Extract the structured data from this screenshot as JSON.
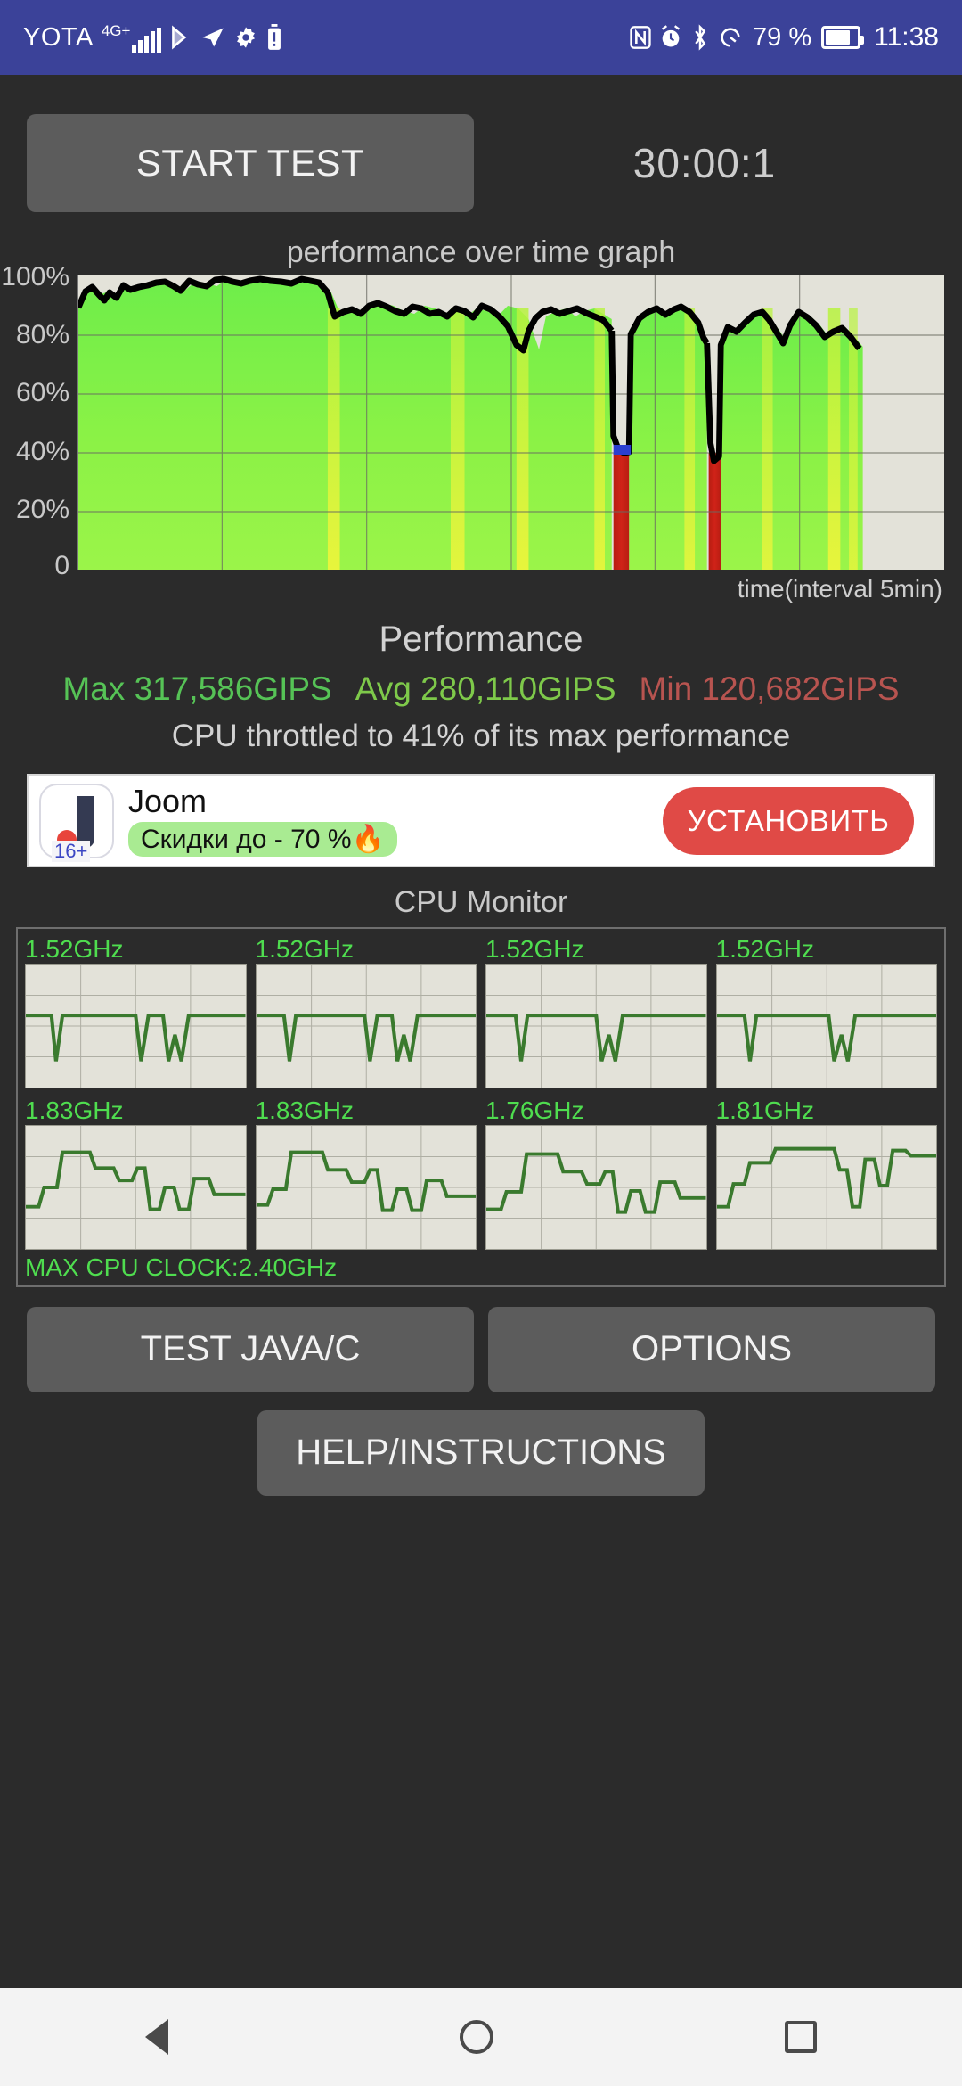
{
  "statusbar": {
    "carrier": "YOTA",
    "network": "4G+",
    "battery_percent": "79 %",
    "clock": "11:38",
    "icons": [
      "signal-bars-icon",
      "bluetooth-share-icon",
      "location-arrow-icon",
      "gear-icon",
      "warning-battery-icon",
      "nfc-icon",
      "alarm-icon",
      "bluetooth-icon",
      "data-saver-icon",
      "battery-icon"
    ]
  },
  "toolbar": {
    "start_label": "START TEST",
    "timer": "30:00:1"
  },
  "graph": {
    "title": "performance over time graph",
    "xaxis_note": "time(interval 5min)",
    "y_ticks": [
      "100%",
      "80%",
      "60%",
      "40%",
      "20%",
      "0"
    ]
  },
  "performance": {
    "heading": "Performance",
    "max_label": "Max 317,586GIPS",
    "avg_label": "Avg 280,110GIPS",
    "min_label": "Min 120,682GIPS",
    "max_color": "#56c356",
    "avg_color": "#7ec94a",
    "min_color": "#b85450",
    "throttle_note": "CPU throttled to 41% of its max performance"
  },
  "ad": {
    "app_name": "Joom",
    "promo": "Скидки до - 70 %🔥",
    "cta_label": "УСТАНОВИТЬ",
    "age_rating": "16+"
  },
  "cpu_monitor": {
    "title": "CPU Monitor",
    "max_clock_label": "MAX CPU CLOCK:2.40GHz",
    "cores": [
      {
        "freq": "1.52GHz"
      },
      {
        "freq": "1.52GHz"
      },
      {
        "freq": "1.52GHz"
      },
      {
        "freq": "1.52GHz"
      },
      {
        "freq": "1.83GHz"
      },
      {
        "freq": "1.83GHz"
      },
      {
        "freq": "1.76GHz"
      },
      {
        "freq": "1.81GHz"
      }
    ]
  },
  "buttons": {
    "test_java": "TEST JAVA/C",
    "options": "OPTIONS",
    "help": "HELP/INSTRUCTIONS"
  },
  "chart_data": {
    "type": "area",
    "title": "performance over time graph",
    "xlabel": "time(interval 5min)",
    "ylabel": "",
    "ylim": [
      0,
      100
    ],
    "ytick_values": [
      100,
      80,
      60,
      40,
      20,
      0
    ],
    "ytick_labels": [
      "100%",
      "80%",
      "60%",
      "40%",
      "20%",
      "0"
    ],
    "grid": true,
    "xlim": [
      0,
      100
    ],
    "series": [
      {
        "name": "performance",
        "x": [
          0,
          0.8,
          1.6,
          2.4,
          3.2,
          4.0,
          4.8,
          5.6,
          6.4,
          7.2,
          8.0,
          8.8,
          9.6,
          10.4,
          11.2,
          12.0,
          12.8,
          13.6,
          14.4,
          15.2,
          16.0,
          16.8,
          17.6,
          18.4,
          19.2,
          20.0,
          20.8,
          21.6,
          22.4,
          23.2,
          24.0,
          24.8,
          25.6,
          26.4,
          27.2,
          28.0,
          28.8,
          29.6,
          30.4,
          31.2,
          32.0,
          32.8,
          33.6,
          34.4,
          35.2,
          36.0,
          36.8,
          37.6,
          38.4,
          39.2,
          40.0,
          40.8,
          41.6,
          42.4,
          43.2,
          44.0,
          44.8,
          45.6,
          46.4,
          47.2,
          48.0,
          48.8,
          49.6,
          50.4,
          51.2,
          52.0,
          52.8,
          53.6,
          54.4,
          55.2,
          56.0,
          56.8,
          57.6,
          58.4,
          59.2,
          60.0,
          60.8,
          61.6,
          62.4,
          63.2,
          64.0,
          64.8,
          65.6,
          66.4,
          67.2,
          68.0,
          68.8,
          69.6,
          70.4,
          71.2,
          72.0,
          72.8,
          73.6
        ],
        "y": [
          90,
          97,
          95,
          94,
          93,
          97,
          95,
          96,
          97,
          98,
          97,
          95,
          98,
          97,
          96,
          99,
          98,
          97,
          98,
          99,
          98,
          98,
          97,
          99,
          98,
          95,
          88,
          90,
          89,
          92,
          93,
          92,
          90,
          89,
          92,
          91,
          89,
          90,
          88,
          91,
          90,
          88,
          92,
          91,
          87,
          74,
          86,
          88,
          89,
          90,
          88,
          89,
          91,
          87,
          41,
          41,
          41,
          41,
          84,
          88,
          90,
          91,
          89,
          88,
          86,
          84,
          39,
          38,
          42,
          82,
          88,
          90,
          92,
          91,
          87,
          90,
          92,
          88,
          84,
          90,
          92,
          86,
          82,
          86,
          90,
          88,
          84,
          78,
          76,
          0,
          0,
          0,
          0
        ],
        "color": "#000000",
        "fill_gradient": [
          "#6eed4a",
          "#e8ff3a",
          "#d02318"
        ]
      }
    ],
    "annotations": [
      {
        "text": "red throttle band",
        "x_range": [
          54.4,
          57.2
        ],
        "color": "#c22118"
      },
      {
        "text": "red throttle band",
        "x_range": [
          66.4,
          68.8
        ],
        "color": "#c22118"
      },
      {
        "text": "empty / not-yet-recorded region",
        "x_range": [
          73.6,
          100
        ],
        "color": "#e3e2d9"
      }
    ]
  }
}
